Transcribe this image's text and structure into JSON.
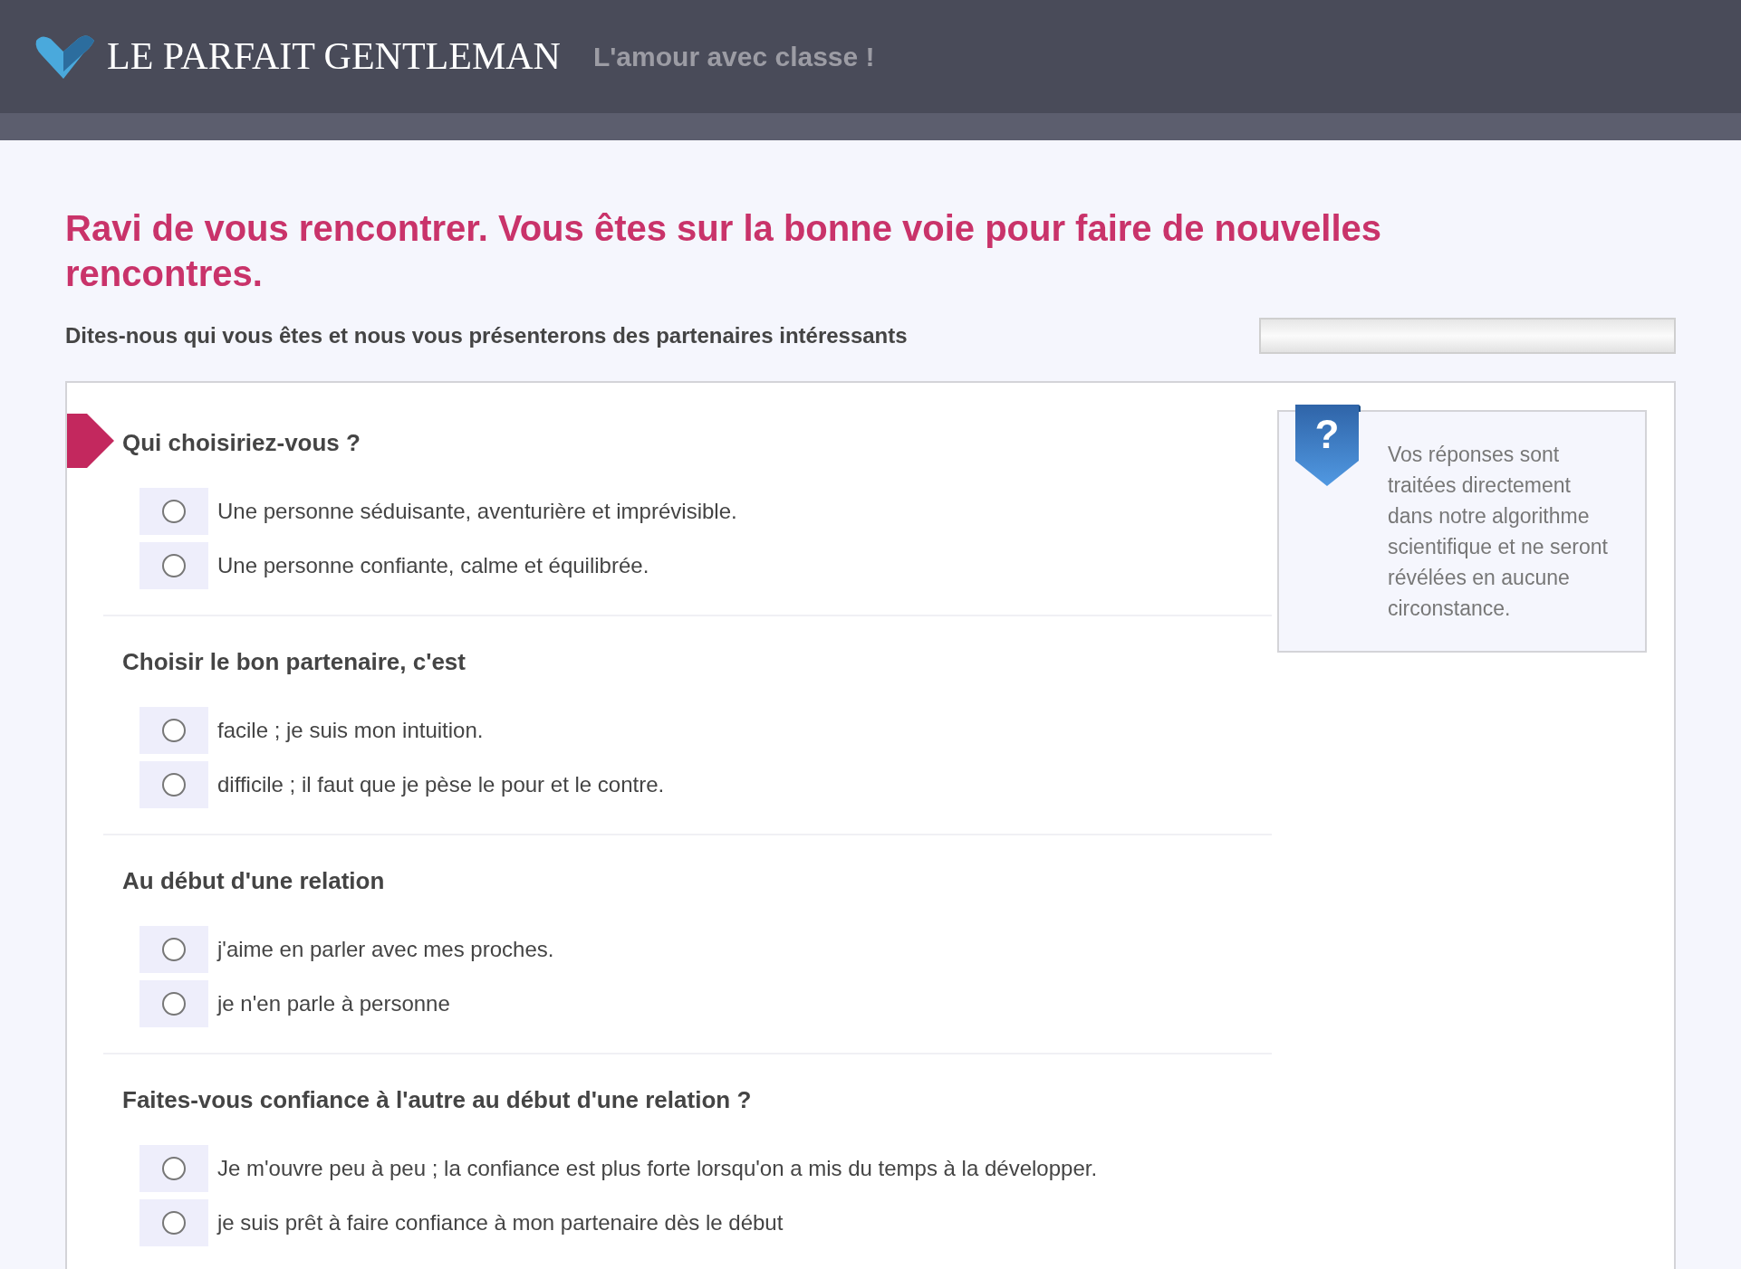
{
  "header": {
    "brand": "LE PARFAIT GENTLEMAN",
    "tagline": "L'amour avec classe !"
  },
  "intro": {
    "title": "Ravi de vous rencontrer. Vous êtes sur la bonne voie pour faire de nouvelles rencontres.",
    "subtitle": "Dites-nous qui vous êtes et nous vous présenterons des partenaires intéressants"
  },
  "progress": {
    "level": 0
  },
  "questions": [
    {
      "title": "Qui choisiriez-vous ?",
      "current": true,
      "options": [
        {
          "label": "Une personne séduisante, aventurière et imprévisible.",
          "selected": false
        },
        {
          "label": "Une personne confiante, calme et équilibrée.",
          "selected": false
        }
      ]
    },
    {
      "title": "Choisir le bon partenaire, c'est",
      "current": false,
      "options": [
        {
          "label": "facile ; je suis mon intuition.",
          "selected": false
        },
        {
          "label": "difficile ; il faut que je pèse le pour et le contre.",
          "selected": false
        }
      ]
    },
    {
      "title": "Au début d'une relation",
      "current": false,
      "options": [
        {
          "label": "j'aime en parler avec mes proches.",
          "selected": false
        },
        {
          "label": "je n'en parle à personne",
          "selected": false
        }
      ]
    },
    {
      "title": "Faites-vous confiance à l'autre au début d'une relation ?",
      "current": false,
      "options": [
        {
          "label": "Je m'ouvre peu à peu ; la confiance est plus forte lorsqu'on a mis du temps à la développer.",
          "selected": false
        },
        {
          "label": "je suis prêt à faire confiance à mon partenaire dès le début",
          "selected": false
        }
      ]
    }
  ],
  "info": {
    "icon": "?",
    "text": "Vos réponses sont traitées directement dans notre algorithme scientifique et ne seront révélées en aucune circonstance."
  }
}
